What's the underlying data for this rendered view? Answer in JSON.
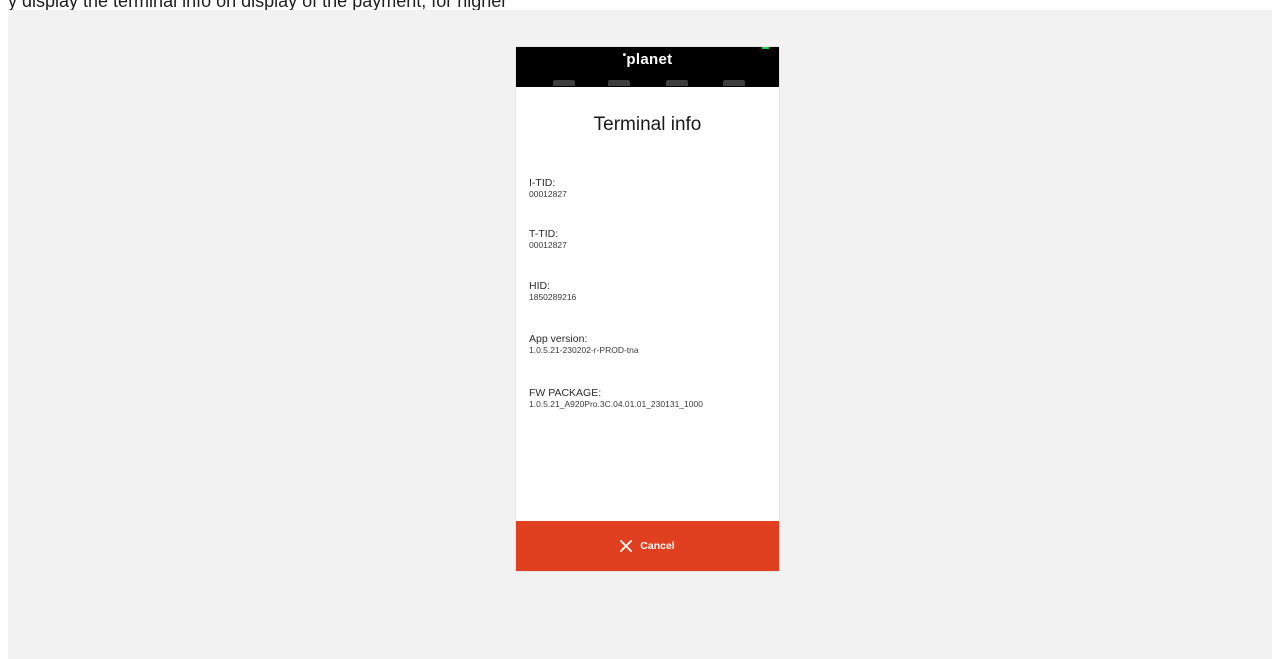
{
  "top_caption": "y                                                             display the terminal info on display of the payment, for higher",
  "device": {
    "brand": "planet",
    "softkey_count": 4,
    "led_color": "#2ecc40"
  },
  "screen": {
    "title": "Terminal info",
    "fields": [
      {
        "label": "I-TID:",
        "value": "00012827"
      },
      {
        "label": "T-TID:",
        "value": "00012827"
      },
      {
        "label": "HID:",
        "value": "1850289216"
      },
      {
        "label": "App version:",
        "value": "1.0.5.21-230202-r-PROD-tna"
      },
      {
        "label": "FW PACKAGE:",
        "value": "1.0.5.21_A920Pro.3C.04.01.01_230131_1000"
      }
    ]
  },
  "cancel_button": {
    "label": "Cancel",
    "icon": "close-icon",
    "color": "#e0401f"
  },
  "colors": {
    "background": "#f2f2f2",
    "header": "#000000",
    "accent": "#e0401f"
  }
}
